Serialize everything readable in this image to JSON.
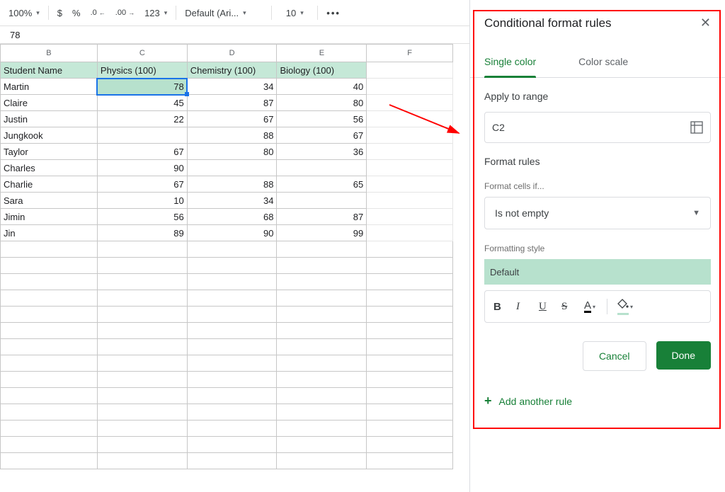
{
  "toolbar": {
    "zoom": "100%",
    "currency": "$",
    "percent": "%",
    "dec_remove": ".0",
    "dec_add": ".00",
    "num_format": "123",
    "font": "Default (Ari...",
    "font_size": "10",
    "more": "•••"
  },
  "formula": {
    "value": "78"
  },
  "columns": [
    "B",
    "C",
    "D",
    "E",
    "F"
  ],
  "headers": {
    "b": "Student Name",
    "c": "Physics (100)",
    "d": "Chemistry (100)",
    "e": "Biology (100)"
  },
  "rows": [
    {
      "b": "Martin",
      "c": "78",
      "d": "34",
      "e": "40"
    },
    {
      "b": "Claire",
      "c": "45",
      "d": "87",
      "e": "80"
    },
    {
      "b": "Justin",
      "c": "22",
      "d": "67",
      "e": "56"
    },
    {
      "b": "Jungkook",
      "c": "",
      "d": "88",
      "e": "67"
    },
    {
      "b": "Taylor",
      "c": "67",
      "d": "80",
      "e": "36"
    },
    {
      "b": "Charles",
      "c": "90",
      "d": "",
      "e": ""
    },
    {
      "b": "Charlie",
      "c": "67",
      "d": "88",
      "e": "65"
    },
    {
      "b": "Sara",
      "c": "10",
      "d": "34",
      "e": ""
    },
    {
      "b": "Jimin",
      "c": "56",
      "d": "68",
      "e": "87"
    },
    {
      "b": "Jin",
      "c": "89",
      "d": "90",
      "e": "99"
    }
  ],
  "panel": {
    "title": "Conditional format rules",
    "tabs": {
      "single": "Single color",
      "scale": "Color scale"
    },
    "apply_label": "Apply to range",
    "range": "C2",
    "rules_label": "Format rules",
    "condition_label": "Format cells if...",
    "condition_value": "Is not empty",
    "style_label": "Formatting style",
    "style_preview": "Default",
    "cancel": "Cancel",
    "done": "Done",
    "add_rule": "Add another rule"
  }
}
